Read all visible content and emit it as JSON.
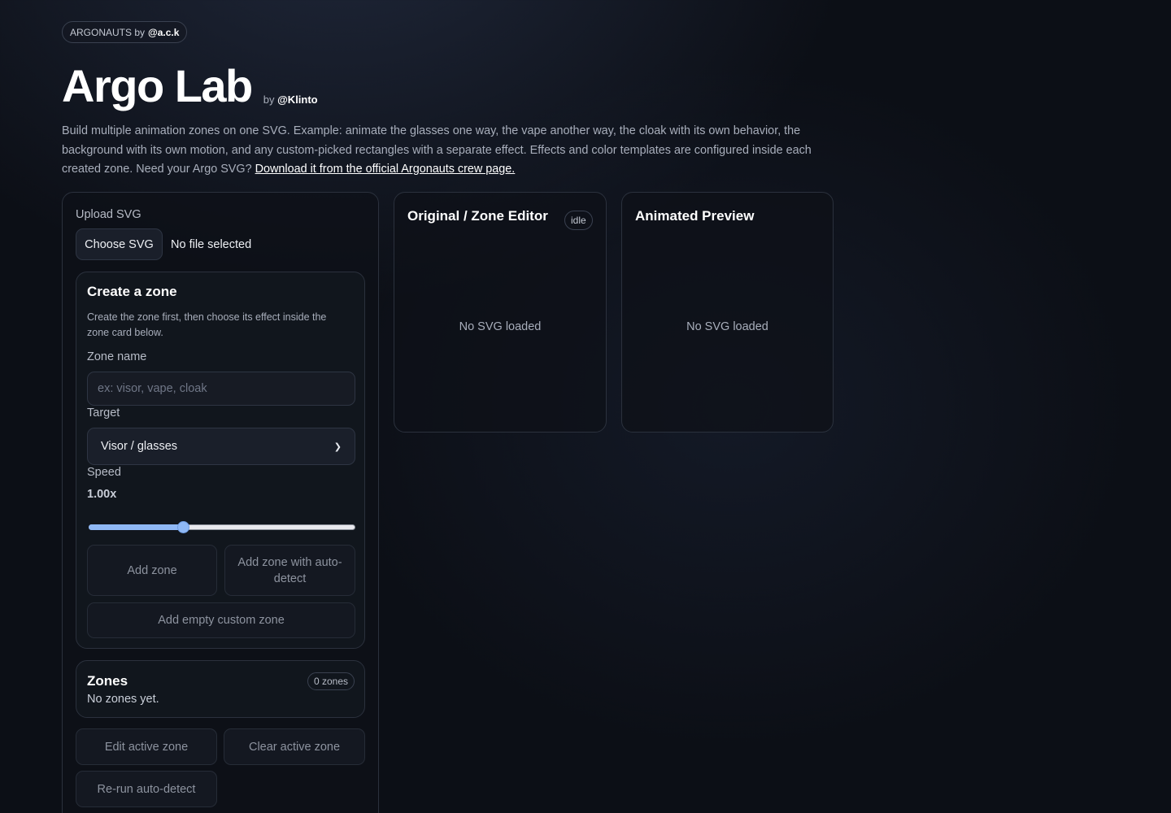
{
  "header": {
    "badge_prefix": "ARGONAUTS by",
    "badge_handle": "@a.c.k",
    "title": "Argo Lab",
    "by_prefix": "by",
    "by_handle": "@Klinto",
    "description": "Build multiple animation zones on one SVG. Example: animate the glasses one way, the vape another way, the cloak with its own behavior, the background with its own motion, and any custom-picked rectangles with a separate effect. Effects and color templates are configured inside each created zone. Need your Argo SVG?",
    "download_link": "Download it from the official Argonauts crew page."
  },
  "upload": {
    "label": "Upload SVG",
    "button": "Choose SVG",
    "status": "No file selected"
  },
  "create_zone": {
    "title": "Create a zone",
    "help": "Create the zone first, then choose its effect inside the zone card below.",
    "name_label": "Zone name",
    "name_placeholder": "ex: visor, vape, cloak",
    "target_label": "Target",
    "target_value": "Visor / glasses",
    "speed_label": "Speed",
    "speed_value": "1.00x",
    "speed_fraction": 0.355,
    "add_zone": "Add zone",
    "add_auto": "Add zone with auto-detect",
    "add_empty": "Add empty custom zone"
  },
  "zones": {
    "title": "Zones",
    "count": "0 zones",
    "empty": "No zones yet."
  },
  "actions": {
    "edit": "Edit active zone",
    "clear": "Clear active zone",
    "rerun": "Re-run auto-detect"
  },
  "editor": {
    "title": "Original / Zone Editor",
    "status": "idle",
    "empty": "No SVG loaded"
  },
  "preview": {
    "title": "Animated Preview",
    "empty": "No SVG loaded"
  },
  "colors": {
    "accent": "#8fb8f5",
    "background": "#0c0f16"
  }
}
